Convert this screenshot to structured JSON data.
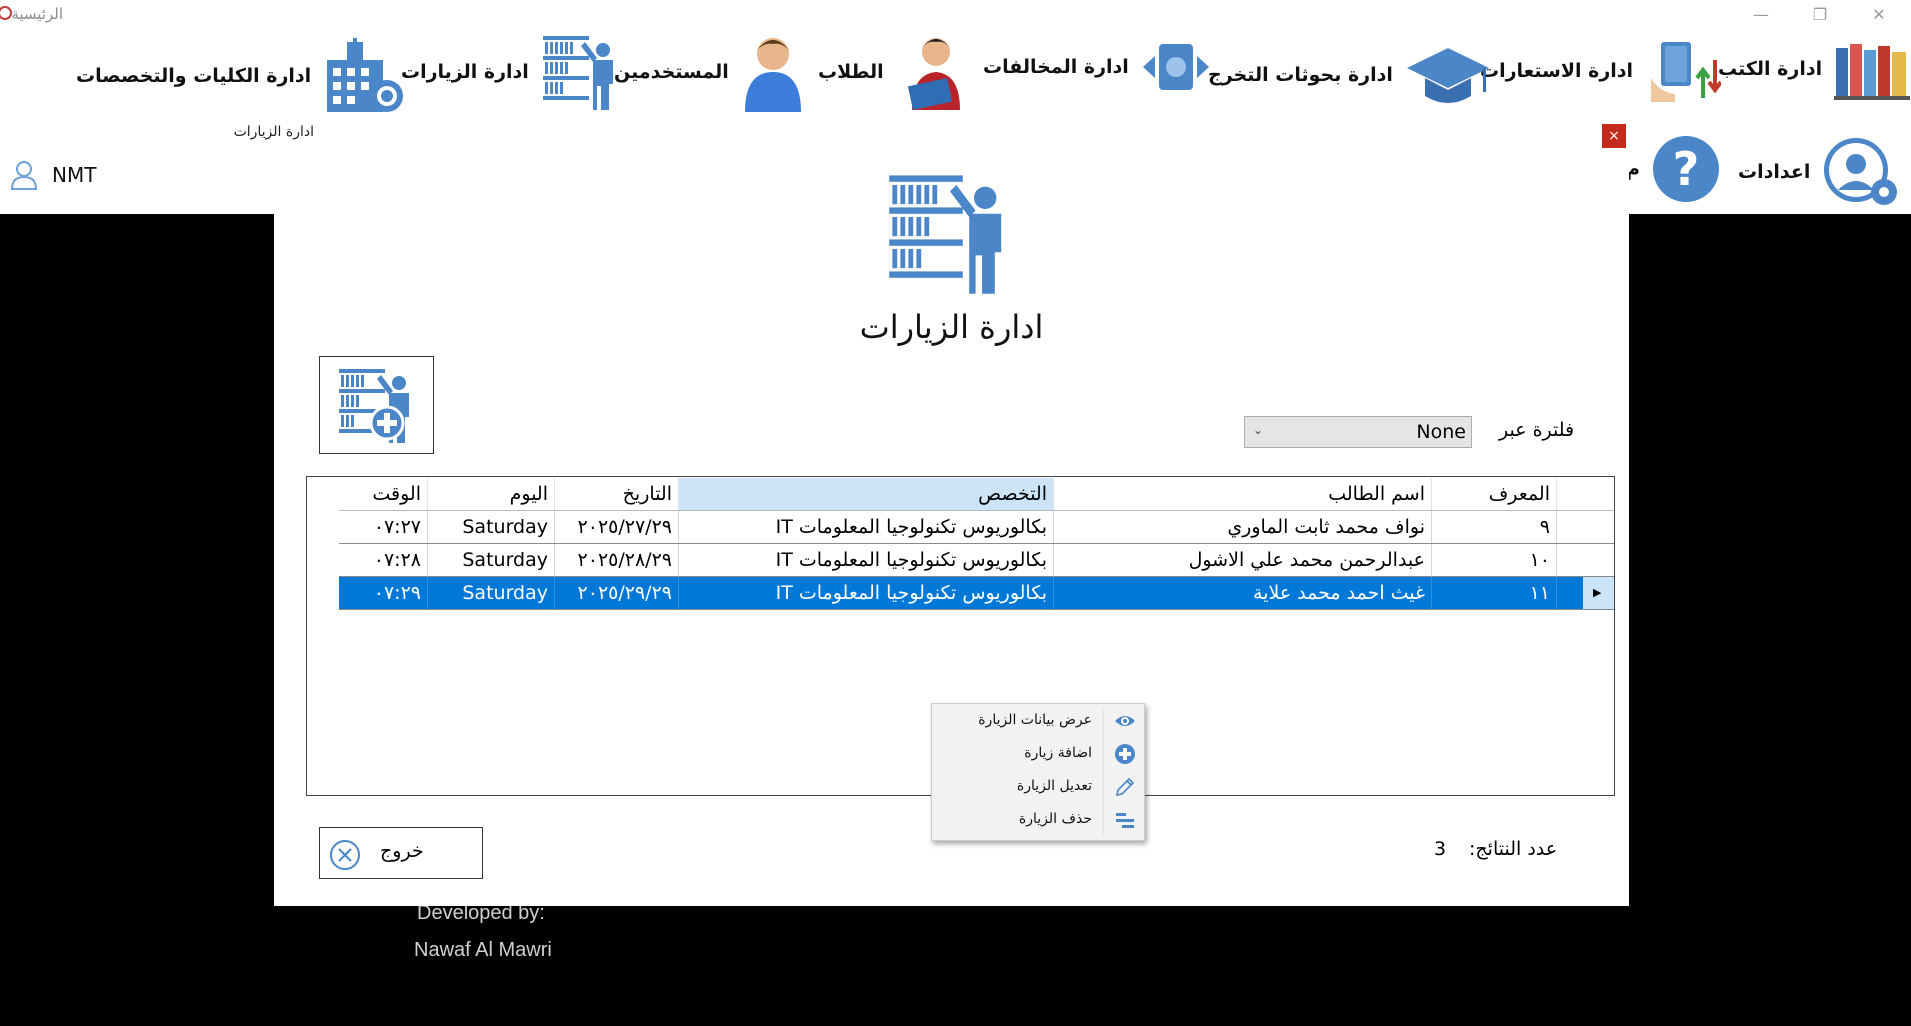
{
  "window": {
    "title": "الرئيسية",
    "controls": {
      "minimize": "—",
      "maximize": "❐",
      "close": "✕"
    }
  },
  "topnav": {
    "books": "ادارة الكتب",
    "borrowing": "ادارة الاستعارات",
    "research": "ادارة بحوثات التخرج",
    "violations": "ادارة المخالفات",
    "students": "الطلاب",
    "users": "المستخدمين",
    "visits": "ادارة الزيارات",
    "colleges": "ادارة الكليات والتخصصات",
    "settings": "اعدادات",
    "help_partial": "م"
  },
  "user": {
    "name": "NMT"
  },
  "credits": {
    "line1": "Developed by:",
    "line2": "Nawaf Al Mawri"
  },
  "dialog": {
    "title": "ادارة الزيارات",
    "heading": "ادارة الزيارات",
    "close": "×",
    "filter": {
      "label": "فلترة عبر",
      "value": "None",
      "chevron": "⌄"
    },
    "table": {
      "columns": {
        "id": "المعرف",
        "name": "اسم الطالب",
        "major": "التخصص",
        "date": "التاريخ",
        "day": "اليوم",
        "time": "الوقت"
      },
      "rows": [
        {
          "id": "٩",
          "name": "نواف محمد ثابت الماوري",
          "major": "بكالوريوس تكنولوجيا المعلومات IT",
          "date": "٢٠٢٥/٢٧/٢٩",
          "day": "Saturday",
          "time": "٠٧:٢٧"
        },
        {
          "id": "١٠",
          "name": "عبدالرحمن محمد علي الاشول",
          "major": "بكالوريوس تكنولوجيا المعلومات IT",
          "date": "٢٠٢٥/٢٨/٢٩",
          "day": "Saturday",
          "time": "٠٧:٢٨"
        },
        {
          "id": "١١",
          "name": "غيث احمد محمد علاية",
          "major": "بكالوريوس تكنولوجيا المعلومات IT",
          "date": "٢٠٢٥/٢٩/٢٩",
          "day": "Saturday",
          "time": "٠٧:٢٩"
        }
      ],
      "selected_row_marker": "▶"
    },
    "context_menu": {
      "view": "عرض بيانات الزيارة",
      "add": "اضافة زيارة",
      "edit": "تعديل الزيارة",
      "delete": "حذف الزيارة"
    },
    "results": {
      "label": "عدد النتائج:",
      "count": "3"
    },
    "exit_label": "خروج"
  },
  "colors": {
    "selection": "#0078d7",
    "icon_blue": "#4a86c8",
    "close_red": "#c42b1c"
  }
}
